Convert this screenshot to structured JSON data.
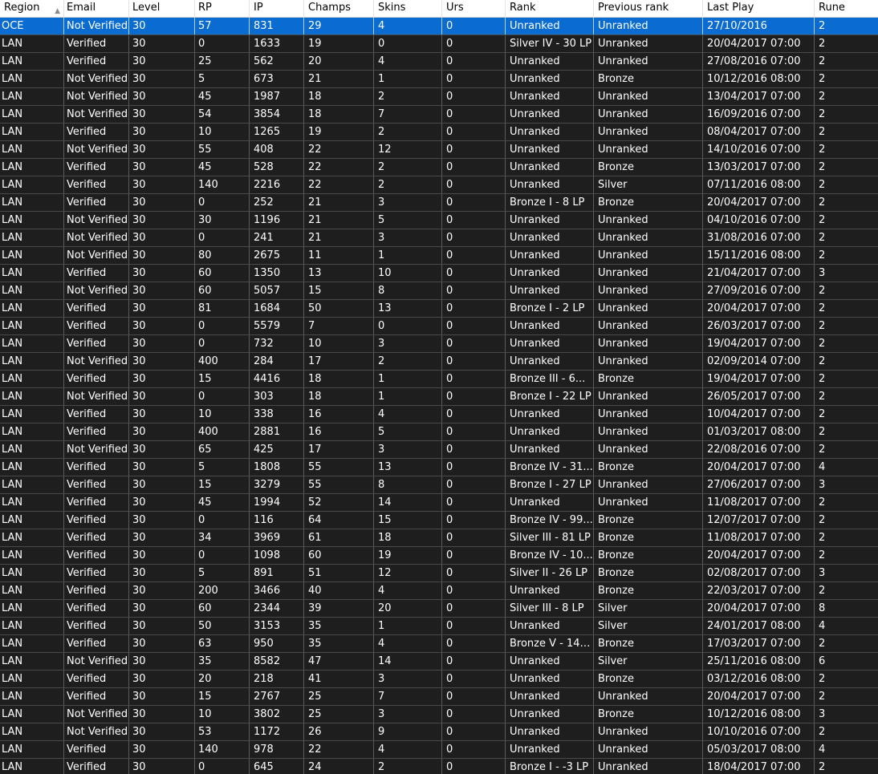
{
  "table": {
    "sort_icon": "sort-ascending-icon",
    "columns": [
      "Region",
      "Email",
      "Level",
      "RP",
      "IP",
      "Champs",
      "Skins",
      "Urs",
      "Rank",
      "Previous rank",
      "Last Play",
      "Rune"
    ],
    "selected_row": 0,
    "rows": [
      [
        "OCE",
        "Not Verified",
        "30",
        "57",
        "831",
        "29",
        "4",
        "0",
        "Unranked",
        "Unranked",
        "27/10/2016",
        "2"
      ],
      [
        "LAN",
        "Verified",
        "30",
        "0",
        "1633",
        "19",
        "0",
        "0",
        "Silver IV - 30 LP",
        "Unranked",
        "20/04/2017 07:00",
        "2"
      ],
      [
        "LAN",
        "Verified",
        "30",
        "25",
        "562",
        "20",
        "4",
        "0",
        "Unranked",
        "Unranked",
        "27/08/2016 07:00",
        "2"
      ],
      [
        "LAN",
        "Not Verified",
        "30",
        "5",
        "673",
        "21",
        "1",
        "0",
        "Unranked",
        "Bronze",
        "10/12/2016 08:00",
        "2"
      ],
      [
        "LAN",
        "Not Verified",
        "30",
        "45",
        "1987",
        "18",
        "2",
        "0",
        "Unranked",
        "Unranked",
        "13/04/2017 07:00",
        "2"
      ],
      [
        "LAN",
        "Not Verified",
        "30",
        "54",
        "3854",
        "18",
        "7",
        "0",
        "Unranked",
        "Unranked",
        "16/09/2016 07:00",
        "2"
      ],
      [
        "LAN",
        "Verified",
        "30",
        "10",
        "1265",
        "19",
        "2",
        "0",
        "Unranked",
        "Unranked",
        "08/04/2017 07:00",
        "2"
      ],
      [
        "LAN",
        "Not Verified",
        "30",
        "55",
        "408",
        "22",
        "12",
        "0",
        "Unranked",
        "Unranked",
        "14/10/2016 07:00",
        "2"
      ],
      [
        "LAN",
        "Verified",
        "30",
        "45",
        "528",
        "22",
        "2",
        "0",
        "Unranked",
        "Bronze",
        "13/03/2017 07:00",
        "2"
      ],
      [
        "LAN",
        "Verified",
        "30",
        "140",
        "2216",
        "22",
        "2",
        "0",
        "Unranked",
        "Silver",
        "07/11/2016 08:00",
        "2"
      ],
      [
        "LAN",
        "Verified",
        "30",
        "0",
        "252",
        "21",
        "3",
        "0",
        "Bronze I - 8 LP",
        "Bronze",
        "20/04/2017 07:00",
        "2"
      ],
      [
        "LAN",
        "Not Verified",
        "30",
        "30",
        "1196",
        "21",
        "5",
        "0",
        "Unranked",
        "Unranked",
        "04/10/2016 07:00",
        "2"
      ],
      [
        "LAN",
        "Not Verified",
        "30",
        "0",
        "241",
        "21",
        "3",
        "0",
        "Unranked",
        "Unranked",
        "31/08/2016 07:00",
        "2"
      ],
      [
        "LAN",
        "Not Verified",
        "30",
        "80",
        "2675",
        "11",
        "1",
        "0",
        "Unranked",
        "Unranked",
        "15/11/2016 08:00",
        "2"
      ],
      [
        "LAN",
        "Verified",
        "30",
        "60",
        "1350",
        "13",
        "10",
        "0",
        "Unranked",
        "Unranked",
        "21/04/2017 07:00",
        "3"
      ],
      [
        "LAN",
        "Not Verified",
        "30",
        "60",
        "5057",
        "15",
        "8",
        "0",
        "Unranked",
        "Unranked",
        "27/09/2016 07:00",
        "2"
      ],
      [
        "LAN",
        "Verified",
        "30",
        "81",
        "1684",
        "50",
        "13",
        "0",
        "Bronze I - 2 LP",
        "Unranked",
        "20/04/2017 07:00",
        "2"
      ],
      [
        "LAN",
        "Verified",
        "30",
        "0",
        "5579",
        "7",
        "0",
        "0",
        "Unranked",
        "Unranked",
        "26/03/2017 07:00",
        "2"
      ],
      [
        "LAN",
        "Verified",
        "30",
        "0",
        "732",
        "10",
        "3",
        "0",
        "Unranked",
        "Unranked",
        "19/04/2017 07:00",
        "2"
      ],
      [
        "LAN",
        "Not Verified",
        "30",
        "400",
        "284",
        "17",
        "2",
        "0",
        "Unranked",
        "Unranked",
        "02/09/2014 07:00",
        "2"
      ],
      [
        "LAN",
        "Verified",
        "30",
        "15",
        "4416",
        "18",
        "1",
        "0",
        "Bronze III - 6...",
        "Bronze",
        "19/04/2017 07:00",
        "2"
      ],
      [
        "LAN",
        "Not Verified",
        "30",
        "0",
        "303",
        "18",
        "1",
        "0",
        "Bronze I - 22 LP",
        "Unranked",
        "26/05/2017 07:00",
        "2"
      ],
      [
        "LAN",
        "Verified",
        "30",
        "10",
        "338",
        "16",
        "4",
        "0",
        "Unranked",
        "Unranked",
        "10/04/2017 07:00",
        "2"
      ],
      [
        "LAN",
        "Verified",
        "30",
        "400",
        "2881",
        "16",
        "5",
        "0",
        "Unranked",
        "Unranked",
        "01/03/2017 08:00",
        "2"
      ],
      [
        "LAN",
        "Not Verified",
        "30",
        "65",
        "425",
        "17",
        "3",
        "0",
        "Unranked",
        "Unranked",
        "22/08/2016 07:00",
        "2"
      ],
      [
        "LAN",
        "Verified",
        "30",
        "5",
        "1808",
        "55",
        "13",
        "0",
        "Bronze IV - 31...",
        "Bronze",
        "20/04/2017 07:00",
        "4"
      ],
      [
        "LAN",
        "Verified",
        "30",
        "15",
        "3279",
        "55",
        "8",
        "0",
        "Bronze I - 27 LP",
        "Unranked",
        "27/06/2017 07:00",
        "3"
      ],
      [
        "LAN",
        "Verified",
        "30",
        "45",
        "1994",
        "52",
        "14",
        "0",
        "Unranked",
        "Unranked",
        "11/08/2017 07:00",
        "2"
      ],
      [
        "LAN",
        "Verified",
        "30",
        "0",
        "116",
        "64",
        "15",
        "0",
        "Bronze IV - 99...",
        "Bronze",
        "12/07/2017 07:00",
        "2"
      ],
      [
        "LAN",
        "Verified",
        "30",
        "34",
        "3969",
        "61",
        "18",
        "0",
        "Silver III - 81 LP",
        "Bronze",
        "11/08/2017 07:00",
        "2"
      ],
      [
        "LAN",
        "Verified",
        "30",
        "0",
        "1098",
        "60",
        "19",
        "0",
        "Bronze IV - 10...",
        "Bronze",
        "20/04/2017 07:00",
        "2"
      ],
      [
        "LAN",
        "Verified",
        "30",
        "5",
        "891",
        "51",
        "12",
        "0",
        "Silver II - 26 LP",
        "Bronze",
        "02/08/2017 07:00",
        "3"
      ],
      [
        "LAN",
        "Verified",
        "30",
        "200",
        "3466",
        "40",
        "4",
        "0",
        "Unranked",
        "Bronze",
        "22/03/2017 07:00",
        "2"
      ],
      [
        "LAN",
        "Verified",
        "30",
        "60",
        "2344",
        "39",
        "20",
        "0",
        "Silver III - 8 LP",
        "Silver",
        "20/04/2017 07:00",
        "8"
      ],
      [
        "LAN",
        "Verified",
        "30",
        "50",
        "3153",
        "35",
        "1",
        "0",
        "Unranked",
        "Silver",
        "24/01/2017 08:00",
        "4"
      ],
      [
        "LAN",
        "Verified",
        "30",
        "63",
        "950",
        "35",
        "4",
        "0",
        "Bronze V - 14 ...",
        "Bronze",
        "17/03/2017 07:00",
        "2"
      ],
      [
        "LAN",
        "Not Verified",
        "30",
        "35",
        "8582",
        "47",
        "14",
        "0",
        "Unranked",
        "Silver",
        "25/11/2016 08:00",
        "6"
      ],
      [
        "LAN",
        "Verified",
        "30",
        "20",
        "218",
        "41",
        "3",
        "0",
        "Unranked",
        "Bronze",
        "03/12/2016 08:00",
        "2"
      ],
      [
        "LAN",
        "Verified",
        "30",
        "15",
        "2767",
        "25",
        "7",
        "0",
        "Unranked",
        "Unranked",
        "20/04/2017 07:00",
        "2"
      ],
      [
        "LAN",
        "Not Verified",
        "30",
        "10",
        "3802",
        "25",
        "3",
        "0",
        "Unranked",
        "Bronze",
        "10/12/2016 08:00",
        "3"
      ],
      [
        "LAN",
        "Not Verified",
        "30",
        "53",
        "1172",
        "26",
        "9",
        "0",
        "Unranked",
        "Unranked",
        "10/10/2016 07:00",
        "2"
      ],
      [
        "LAN",
        "Verified",
        "30",
        "140",
        "978",
        "22",
        "4",
        "0",
        "Unranked",
        "Unranked",
        "05/03/2017 08:00",
        "4"
      ],
      [
        "LAN",
        "Verified",
        "30",
        "0",
        "645",
        "24",
        "2",
        "0",
        "Bronze I - -3 LP",
        "Unranked",
        "18/04/2017 07:00",
        "2"
      ]
    ]
  },
  "colors": {
    "background": "#1e1e1e",
    "selection": "#0a6bd0",
    "header_background": "#ffffff",
    "text": "#ffffff"
  }
}
